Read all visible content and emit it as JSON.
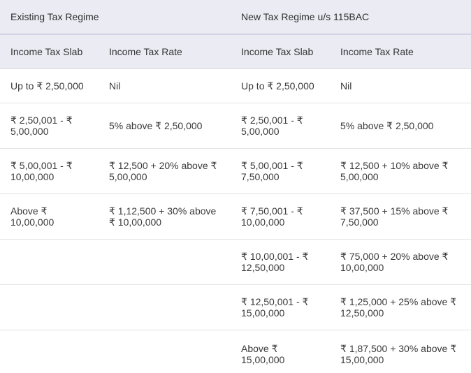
{
  "table": {
    "regimes": {
      "existing": "Existing Tax Regime",
      "new": "New Tax Regime u/s 115BAC"
    },
    "headers": {
      "existing_slab": "Income Tax Slab",
      "existing_rate": "Income Tax Rate",
      "new_slab": "Income Tax Slab",
      "new_rate": "Income Tax Rate"
    },
    "rows": [
      {
        "existing_slab": "Up to ₹ 2,50,000",
        "existing_rate": "Nil",
        "new_slab": "Up to ₹ 2,50,000",
        "new_rate": "Nil"
      },
      {
        "existing_slab": "₹ 2,50,001 - ₹ 5,00,000",
        "existing_rate": "5% above ₹ 2,50,000",
        "new_slab": "₹ 2,50,001 - ₹ 5,00,000",
        "new_rate": "5% above ₹ 2,50,000"
      },
      {
        "existing_slab": "₹ 5,00,001 - ₹ 10,00,000",
        "existing_rate": "₹ 12,500 + 20% above ₹ 5,00,000",
        "new_slab": "₹ 5,00,001 - ₹ 7,50,000",
        "new_rate": "₹ 12,500 + 10% above ₹ 5,00,000"
      },
      {
        "existing_slab": "Above ₹ 10,00,000",
        "existing_rate": "₹ 1,12,500 + 30% above ₹ 10,00,000",
        "new_slab": "₹ 7,50,001 - ₹ 10,00,000",
        "new_rate": "₹ 37,500 + 15% above ₹ 7,50,000"
      },
      {
        "existing_slab": "",
        "existing_rate": "",
        "new_slab": "₹ 10,00,001 - ₹ 12,50,000",
        "new_rate": "₹ 75,000 + 20% above ₹ 10,00,000"
      },
      {
        "existing_slab": "",
        "existing_rate": "",
        "new_slab": "₹ 12,50,001 - ₹ 15,00,000",
        "new_rate": "₹ 1,25,000 + 25% above ₹ 12,50,000"
      },
      {
        "existing_slab": "",
        "existing_rate": "",
        "new_slab": "Above ₹ 15,00,000",
        "new_rate": "₹ 1,87,500 + 30% above ₹ 15,00,000"
      }
    ]
  }
}
